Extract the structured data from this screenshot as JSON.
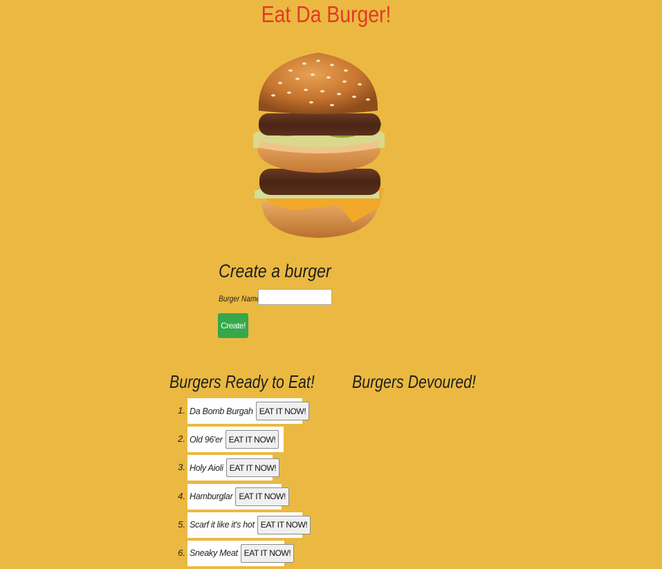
{
  "page": {
    "title": "Eat Da Burger!"
  },
  "hero": {
    "image_icon": "big-mac-burger-photo"
  },
  "create_form": {
    "heading": "Create a burger",
    "name_label": "Burger Name:",
    "name_value": "",
    "submit_label": "Create!"
  },
  "ready": {
    "heading": "Burgers Ready to Eat!",
    "items": [
      {
        "num": "1.",
        "name": "Da Bomb Burgah",
        "button": "EAT IT NOW!"
      },
      {
        "num": "2.",
        "name": "Old 96'er",
        "button": "EAT IT NOW!"
      },
      {
        "num": "3.",
        "name": "Holy Aioli",
        "button": "EAT IT NOW!"
      },
      {
        "num": "4.",
        "name": "Hamburglar",
        "button": "EAT IT NOW!"
      },
      {
        "num": "5.",
        "name": "Scarf it like it's hot",
        "button": "EAT IT NOW!"
      },
      {
        "num": "6.",
        "name": "Sneaky Meat",
        "button": "EAT IT NOW!"
      }
    ]
  },
  "devoured": {
    "heading": "Burgers Devoured!",
    "items": []
  },
  "colors": {
    "background": "#ebb941",
    "title": "#e23a26",
    "create_button": "#35a84a"
  }
}
